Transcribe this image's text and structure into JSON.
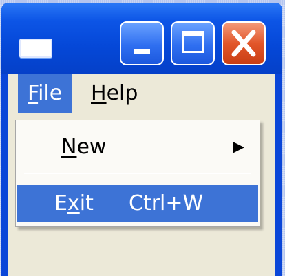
{
  "window": {
    "titlebar_buttons": {
      "minimize": "minimize",
      "maximize": "maximize",
      "close": "close"
    },
    "app_icon": "window-icon"
  },
  "menubar": {
    "items": [
      {
        "label_mnemonic": "F",
        "label_rest": "ile"
      },
      {
        "label_mnemonic": "H",
        "label_rest": "elp"
      }
    ]
  },
  "file_menu": {
    "items": [
      {
        "label_mnemonic": "N",
        "label_rest": "ew",
        "has_submenu": true,
        "submenu_arrow": "▶"
      },
      {
        "label_pre": "E",
        "label_mnemonic": "x",
        "label_rest": "it",
        "shortcut": "Ctrl+W",
        "highlighted": true
      }
    ]
  },
  "colors": {
    "titlebar": "#0548d8",
    "highlight": "#3d73d6",
    "close_button": "#e2562a",
    "client_bg": "#ece9d8"
  }
}
